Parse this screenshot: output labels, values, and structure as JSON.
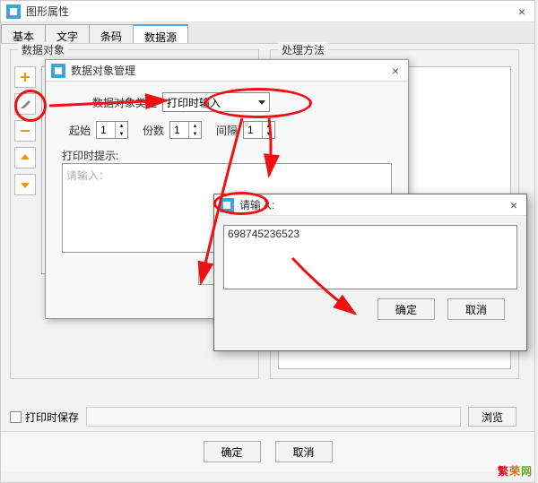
{
  "main": {
    "title": "图形属性",
    "tabs": [
      "基本",
      "文字",
      "条码",
      "数据源"
    ],
    "active_tab": 3,
    "fieldset_dataobj": "数据对象",
    "fieldset_method": "处理方法",
    "save_on_print_label": "打印时保存",
    "browse_label": "浏览",
    "ok_label": "确定",
    "cancel_label": "取消"
  },
  "data_mgr": {
    "title": "数据对象管理",
    "type_label": "数据对象类型",
    "type_value": "打印时输入",
    "start_label": "起始",
    "start_value": "1",
    "copies_label": "份数",
    "copies_value": "1",
    "gap_label": "间隔",
    "gap_value": "1",
    "prompt_label": "打印时提示:",
    "prompt_placeholder": "请输入：",
    "edit_label": "编辑"
  },
  "input_dlg": {
    "title": "请输入:",
    "value": "698745236523",
    "ok_label": "确定",
    "cancel_label": "取消"
  },
  "watermark": {
    "a": "繁",
    "b": "荣",
    "c": "网"
  }
}
